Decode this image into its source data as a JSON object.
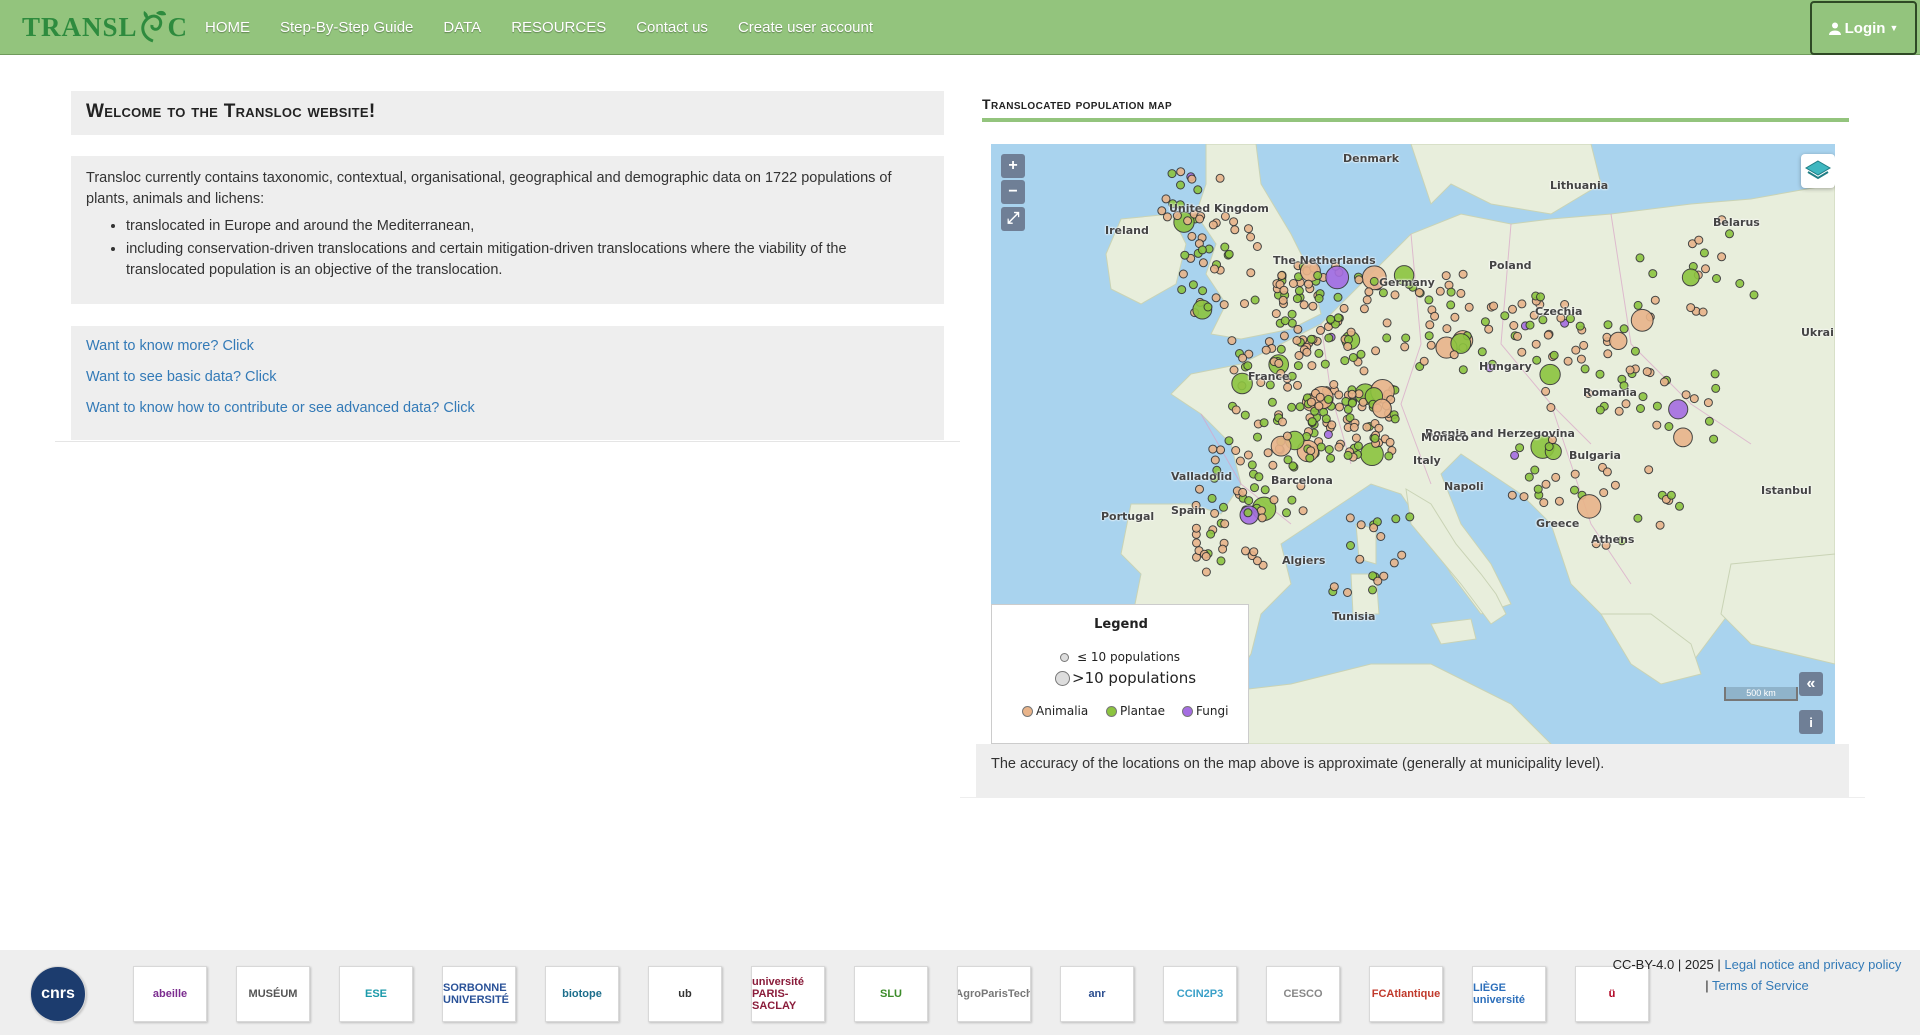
{
  "brand": {
    "logo_left": "TRANSL",
    "logo_right": "C"
  },
  "nav": {
    "items": [
      "HOME",
      "Step-By-Step Guide",
      "DATA",
      "RESOURCES",
      "Contact us",
      "Create user account"
    ],
    "login_label": "Login"
  },
  "welcome": {
    "title": "Welcome to the Transloc website!"
  },
  "intro": {
    "text": "Transloc currently contains taxonomic, contextual, organisational, geographical and demographic data on 1722 populations of plants, animals and lichens:",
    "bullets": [
      "translocated in Europe and around the Mediterranean,",
      "including conservation-driven translocations and certain mitigation-driven translocations where the viability of the translocated population is an objective of the translocation."
    ]
  },
  "links": [
    "Want to know more? Click",
    "Want to see basic data? Click",
    "Want to know how to contribute or see advanced data? Click"
  ],
  "map_panel": {
    "title": "Translocated population map",
    "controls": {
      "zoom_in": "+",
      "zoom_out": "−",
      "fullscreen": "⤢",
      "collapse": "«",
      "info": "i"
    },
    "scale_label": "500 km",
    "place_labels": [
      "Denmark",
      "United Kingdom",
      "Ireland",
      "The Netherlands",
      "Germany",
      "Poland",
      "Lithuania",
      "Belarus",
      "Czechia",
      "France",
      "Hungary",
      "Romania",
      "Ukrai",
      "Bosnia and Herzegovina",
      "Italy",
      "Bulgaria",
      "Spain",
      "Portugal",
      "Greece",
      "Tunisia",
      "Barcelona",
      "Algiers",
      "Napoli",
      "Istanbul",
      "Athens",
      "Valladolid",
      "Monaco"
    ],
    "legend": {
      "title": "Legend",
      "small": "≤ 10 populations",
      "large": ">10 populations",
      "kingdoms": [
        "Animalia",
        "Plantae",
        "Fungi"
      ],
      "colors": {
        "animalia": "#e9b48a",
        "plantae": "#8cc43f",
        "fungi": "#a56de2"
      }
    },
    "caption": "The accuracy of the locations on the map above is approximate (generally at municipality level)."
  },
  "partners": [
    "cnrs",
    "abeille",
    "MUSÉUM",
    "ESE",
    "SORBONNE UNIVERSITÉ",
    "biotope",
    "ub",
    "université PARIS-SACLAY",
    "SLU",
    "AgroParisTech",
    "anr",
    "CCIN2P3",
    "CESCO",
    "FCAtlantique",
    "LIÈGE université",
    "ü"
  ],
  "footer": {
    "license": "CC-BY-4.0 | 2025 | ",
    "legal_link": "Legal notice and privacy policy",
    "sep": " | ",
    "tos_link": "Terms of Service"
  }
}
